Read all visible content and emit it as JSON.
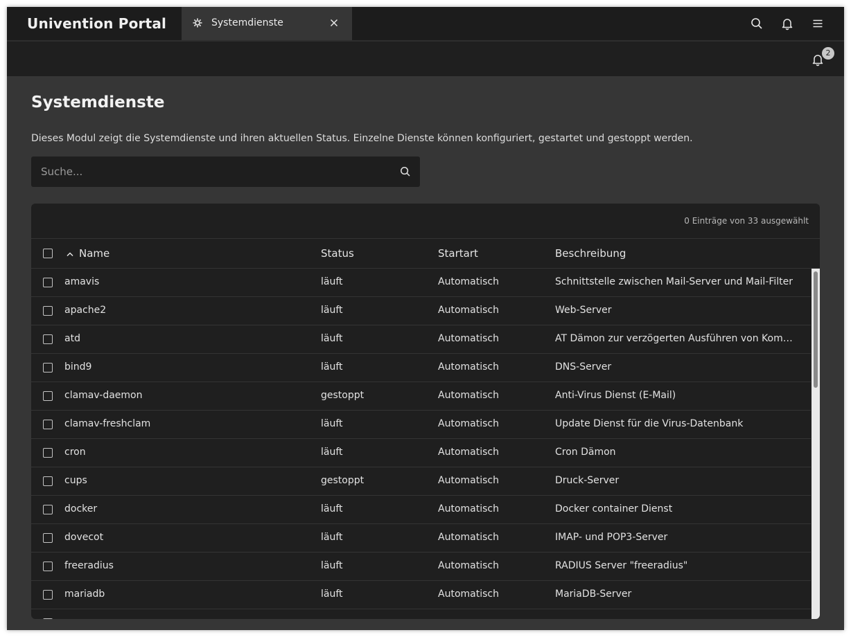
{
  "topbar": {
    "portal_title": "Univention Portal",
    "tab_label": "Systemdienste",
    "icons": [
      "search-icon",
      "bell-icon",
      "menu-icon"
    ]
  },
  "toolbar": {
    "notification_count": "2"
  },
  "page": {
    "title": "Systemdienste",
    "description": "Dieses Modul zeigt die Systemdienste und ihren aktuellen Status. Einzelne Dienste können konfiguriert, gestartet und gestoppt werden."
  },
  "search": {
    "placeholder": "Suche..."
  },
  "grid": {
    "selection_status": "0 Einträge von 33 ausgewählt",
    "columns": {
      "name": "Name",
      "status": "Status",
      "startart": "Startart",
      "beschreibung": "Beschreibung"
    },
    "rows": [
      {
        "name": "amavis",
        "status": "läuft",
        "startart": "Automatisch",
        "beschreibung": "Schnittstelle zwischen Mail-Server und Mail-Filter"
      },
      {
        "name": "apache2",
        "status": "läuft",
        "startart": "Automatisch",
        "beschreibung": "Web-Server"
      },
      {
        "name": "atd",
        "status": "läuft",
        "startart": "Automatisch",
        "beschreibung": "AT Dämon zur verzögerten Ausführen von Komman…"
      },
      {
        "name": "bind9",
        "status": "läuft",
        "startart": "Automatisch",
        "beschreibung": "DNS-Server"
      },
      {
        "name": "clamav-daemon",
        "status": "gestoppt",
        "startart": "Automatisch",
        "beschreibung": "Anti-Virus Dienst (E-Mail)"
      },
      {
        "name": "clamav-freshclam",
        "status": "läuft",
        "startart": "Automatisch",
        "beschreibung": "Update Dienst für die Virus-Datenbank"
      },
      {
        "name": "cron",
        "status": "läuft",
        "startart": "Automatisch",
        "beschreibung": "Cron Dämon"
      },
      {
        "name": "cups",
        "status": "gestoppt",
        "startart": "Automatisch",
        "beschreibung": "Druck-Server"
      },
      {
        "name": "docker",
        "status": "läuft",
        "startart": "Automatisch",
        "beschreibung": "Docker container Dienst"
      },
      {
        "name": "dovecot",
        "status": "läuft",
        "startart": "Automatisch",
        "beschreibung": "IMAP- und POP3-Server"
      },
      {
        "name": "freeradius",
        "status": "läuft",
        "startart": "Automatisch",
        "beschreibung": "RADIUS Server \"freeradius\""
      },
      {
        "name": "mariadb",
        "status": "läuft",
        "startart": "Automatisch",
        "beschreibung": "MariaDB-Server"
      },
      {
        "name": "",
        "status": "",
        "startart": "",
        "beschreibung": ""
      }
    ]
  },
  "colors": {
    "background": "#363636",
    "topbar": "#1c1c1c",
    "surface": "#1f1f1f",
    "text": "#e6e6e6"
  }
}
